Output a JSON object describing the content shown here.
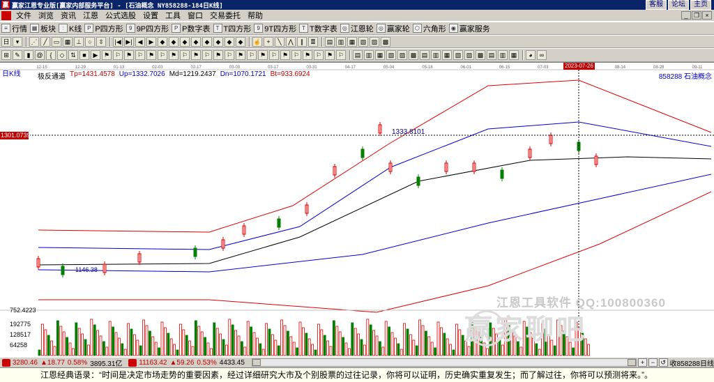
{
  "window": {
    "title": "赢家江恩专业版[赢家内部服务平台] - [石油概念  NY858288-184日K线]",
    "links": [
      "客服",
      "论坛",
      "主页"
    ]
  },
  "menu": [
    "文件",
    "浏览",
    "资讯",
    "江恩",
    "公式选股",
    "设置",
    "工具",
    "窗口",
    "交易委托",
    "帮助"
  ],
  "toolbar1": [
    "行情",
    "板块",
    "K线",
    "P四方形",
    "9P四方形",
    "P数字表",
    "T四方形",
    "9T四方形",
    "T数字表",
    "江恩轮",
    "赢家轮",
    "六角形",
    "赢家服务"
  ],
  "chart": {
    "period": "日K线",
    "indicator": {
      "name": "极反通道",
      "tp": "Tp=1431.4578",
      "up": "Up=1332.7026",
      "md": "Md=1219.2437",
      "dn": "Dn=1070.1721",
      "bt": "Bt=933.6924"
    },
    "stock_code": "858288  石油概念",
    "cursor_price": "1301.0739",
    "cursor_date": "2023-07-26",
    "peak_label": "1333.8101",
    "low_label": "1146.38",
    "date_ticks": [
      "12-15",
      "12-29",
      "01-13",
      "02-03",
      "02-17",
      "03-03",
      "03-17",
      "03-31",
      "04-17",
      "05-04",
      "05-18",
      "06-01",
      "06-15",
      "07-03",
      "07-17",
      "08-14",
      "08-28",
      "09-11"
    ],
    "volume_labels": [
      "752.4223",
      "192775",
      "128517",
      "64258"
    ],
    "watermark_1": "江恩工具软件  QQ:100800360",
    "watermark_2": "赢家聊吧"
  },
  "statusbar": {
    "sh_value": "3280.46",
    "sh_change": "▲18.77",
    "sh_pct": "0.58%",
    "sh_amount": "3895.31亿",
    "sz_value": "11163.42",
    "sz_change": "▲59.26",
    "sz_pct": "0.53%",
    "sz_amount": "4433.45",
    "right_label": "收858288日线"
  },
  "quote": "江恩经典语录：“时间是决定市场走势的重要因素，经过详细研究大市及个别股票的过往记录，你将可以证明，历史确实重复发生；而了解过往，你将可以预测将来。”。",
  "colors": {
    "up_candle": "#e00000",
    "down_candle": "#008000",
    "red_band": "#e00000",
    "blue_band": "#0000d0",
    "mid_band": "#000000"
  }
}
